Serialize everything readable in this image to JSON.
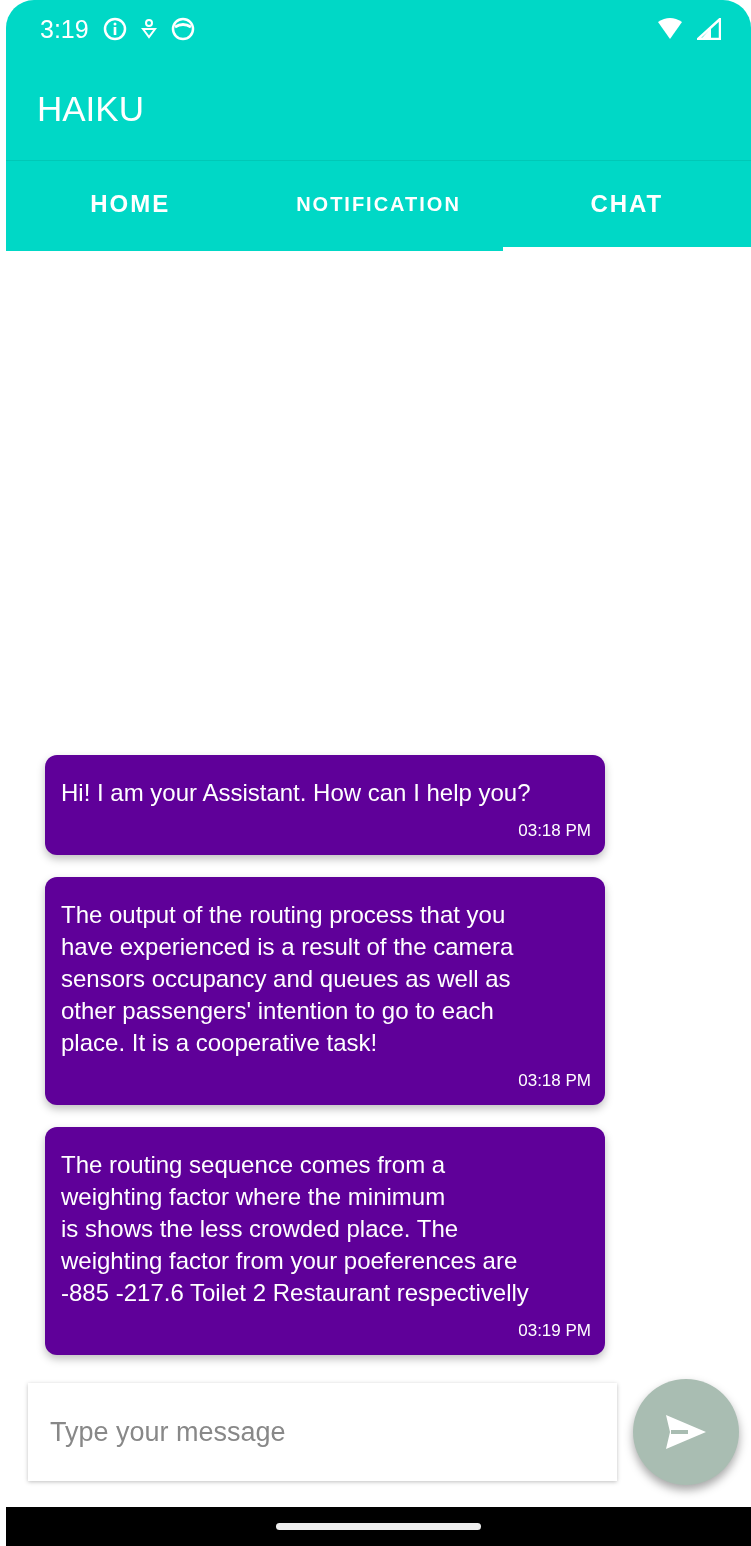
{
  "status_bar": {
    "time": "3:19"
  },
  "app_bar": {
    "title": "HAIKU"
  },
  "tabs": [
    {
      "label": "HOME",
      "selected": false
    },
    {
      "label": "NOTIFICATION",
      "selected": false
    },
    {
      "label": "CHAT",
      "selected": true
    }
  ],
  "messages": [
    {
      "text": "Hi! I am your Assistant. How can I help you?",
      "time": "03:18 PM"
    },
    {
      "text": "The output of the routing process that you\nhave experienced is a result of the camera\nsensors occupancy and queues as well as\nother passengers' intention to go to each\nplace. It is a cooperative task!",
      "time": "03:18 PM"
    },
    {
      "text": "The routing sequence comes from a\nweighting factor where the minimum\nis shows the less crowded place. The\nweighting factor from your poeferences are\n-885 -217.6 Toilet 2 Restaurant respectivelly",
      "time": "03:19 PM"
    }
  ],
  "composer": {
    "placeholder": "Type your message"
  }
}
